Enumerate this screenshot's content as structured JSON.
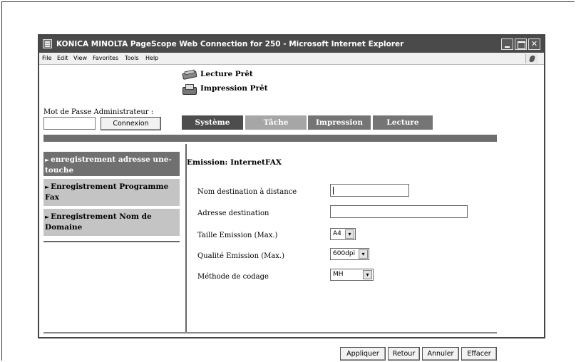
{
  "window": {
    "title": "KONICA MINOLTA PageScope Web Connection for 250 - Microsoft Internet Explorer",
    "controls": {
      "minimize": "",
      "maximize": "",
      "close": "✕"
    }
  },
  "menubar": {
    "items": [
      "File",
      "Edit",
      "View",
      "Favorites",
      "Tools",
      "Help"
    ]
  },
  "status": {
    "scan": "Lecture Prêt",
    "print": "Impression Prêt"
  },
  "admin": {
    "label": "Mot de Passe Administrateur :",
    "password_value": "",
    "connect_label": "Connexion"
  },
  "tabs": [
    "Système",
    "Tâche",
    "Impression",
    "Lecture"
  ],
  "sidebar": {
    "items": [
      {
        "label": "enregistrement adresse une-touche",
        "arrow": "►"
      },
      {
        "label": "Enregistrement Programme Fax",
        "arrow": "►"
      },
      {
        "label": "Enregistrement Nom de Domaine",
        "arrow": "►"
      }
    ]
  },
  "form": {
    "title": "Emission: InternetFAX",
    "fields": [
      {
        "label": "Nom destination à distance",
        "value": ""
      },
      {
        "label": "Adresse destination",
        "value": ""
      },
      {
        "label": "Taille Emission (Max.)",
        "value": "A4"
      },
      {
        "label": "Qualité Emission (Max.)",
        "value": "600dpi"
      },
      {
        "label": "Méthode de codage",
        "value": "MH"
      }
    ],
    "caret": "▾"
  },
  "actions": {
    "apply": "Appliquer",
    "back": "Retour",
    "cancel": "Annuler",
    "clear": "Effacer"
  }
}
